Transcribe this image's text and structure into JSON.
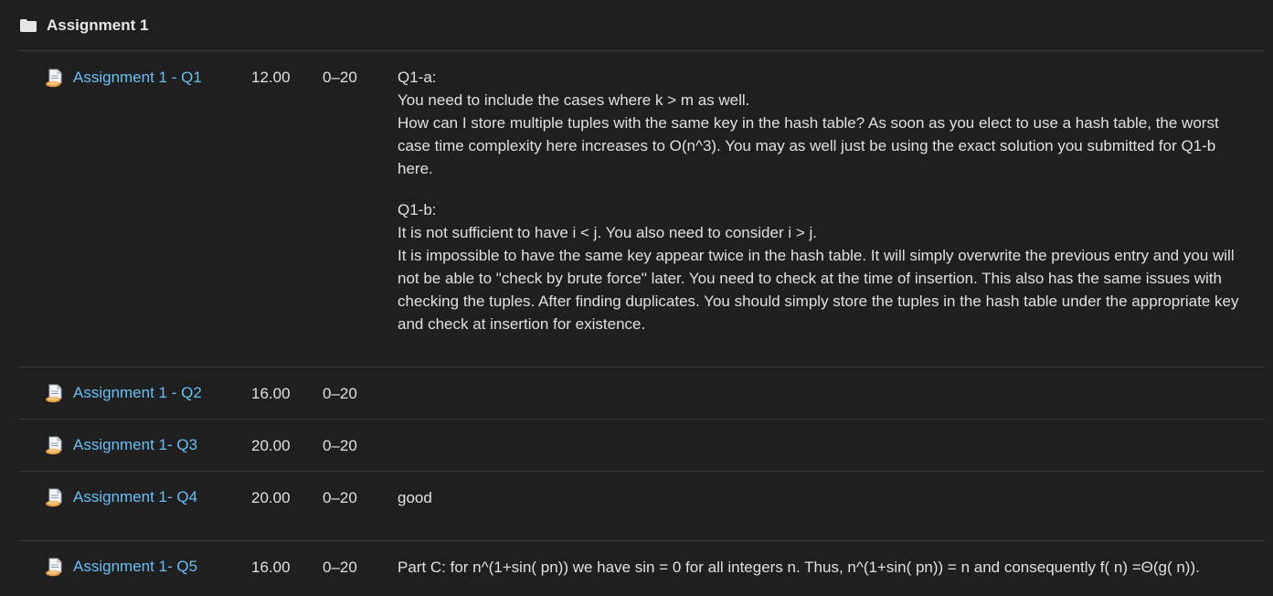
{
  "category": {
    "icon": "folder-icon",
    "title": "Assignment 1"
  },
  "rows": [
    {
      "icon": "assignment-icon",
      "name": "Assignment 1 - Q1",
      "grade": "12.00",
      "range": "0–20",
      "feedback": {
        "p1_heading": "Q1-a:",
        "p1_line1": "You need to include the cases where k > m as well.",
        "p1_line2": "How can I store multiple tuples with the same key in the hash table? As soon as you elect to use a hash table, the worst case time complexity here increases to O(n^3). You may as well just be using the exact solution you submitted for Q1-b here.",
        "p2_heading": "Q1-b:",
        "p2_line1": "It is not sufficient to have i < j. You also need to consider i > j.",
        "p2_line2": "It is impossible to have the same key appear twice in the hash table. It will simply overwrite the previous entry and you will not be able to \"check by brute force\" later. You need to check at the time of insertion. This also has the same issues with checking the tuples. After finding duplicates. You should simply store the tuples in the hash table under the appropriate key and check at insertion for existence."
      }
    },
    {
      "icon": "assignment-icon",
      "name": "Assignment 1 - Q2",
      "grade": "16.00",
      "range": "0–20",
      "feedback": ""
    },
    {
      "icon": "assignment-icon",
      "name": "Assignment 1- Q3",
      "grade": "20.00",
      "range": "0–20",
      "feedback": ""
    },
    {
      "icon": "assignment-icon",
      "name": "Assignment 1- Q4",
      "grade": "20.00",
      "range": "0–20",
      "feedback": "good"
    },
    {
      "icon": "assignment-icon",
      "name": "Assignment 1- Q5",
      "grade": "16.00",
      "range": "0–20",
      "feedback": "Part C: for n^(1+sin( pn)) we have sin = 0 for all integers n. Thus, n^(1+sin( pn)) = n and consequently f( n) =Θ(g( n))."
    }
  ],
  "colors": {
    "background": "#1f1f1f",
    "link": "#66c0f4",
    "text": "#e0e0e0",
    "divider": "#3a3a3a"
  }
}
